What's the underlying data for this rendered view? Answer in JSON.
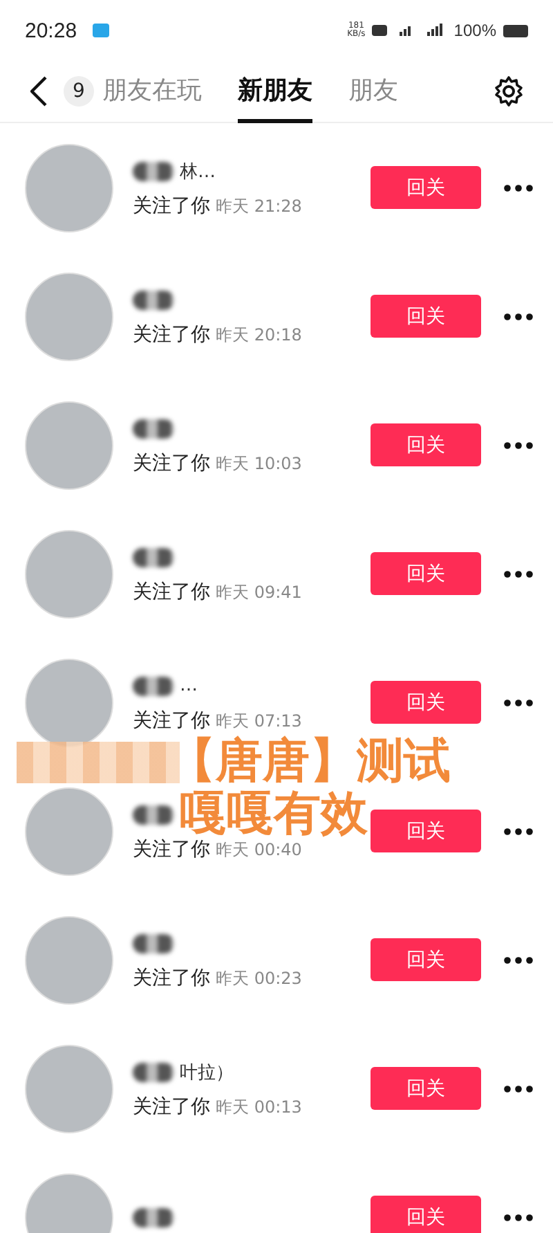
{
  "status_bar": {
    "time": "20:28",
    "speed": "181\nKB/s",
    "battery": "100%"
  },
  "tabs": [
    {
      "label": "朋友在玩",
      "badge": "9",
      "selected": false
    },
    {
      "label": "新朋友",
      "selected": true
    },
    {
      "label": "朋友",
      "selected": false
    }
  ],
  "rows": [
    {
      "name_tail": "林…",
      "subtitle": "关注了你",
      "time": "昨天 21:28",
      "button": "回关"
    },
    {
      "subtitle": "关注了你",
      "time": "昨天 20:18",
      "button": "回关"
    },
    {
      "subtitle": "关注了你",
      "time": "昨天 10:03",
      "button": "回关"
    },
    {
      "subtitle": "关注了你",
      "time": "昨天 09:41",
      "button": "回关"
    },
    {
      "name_tail": "…",
      "subtitle": "关注了你",
      "time": "昨天 07:13",
      "button": "回关"
    },
    {
      "subtitle": "关注了你",
      "time": "昨天 00:40",
      "button": "回关"
    },
    {
      "subtitle": "关注了你",
      "time": "昨天 00:23",
      "button": "回关"
    },
    {
      "name_tail": "叶拉）",
      "subtitle": "关注了你",
      "time": "昨天 00:13",
      "button": "回关"
    },
    {
      "button": "回关"
    }
  ],
  "overlay": {
    "line_1": "【唐唐】测试",
    "line_2": "嘎嘎有效"
  }
}
